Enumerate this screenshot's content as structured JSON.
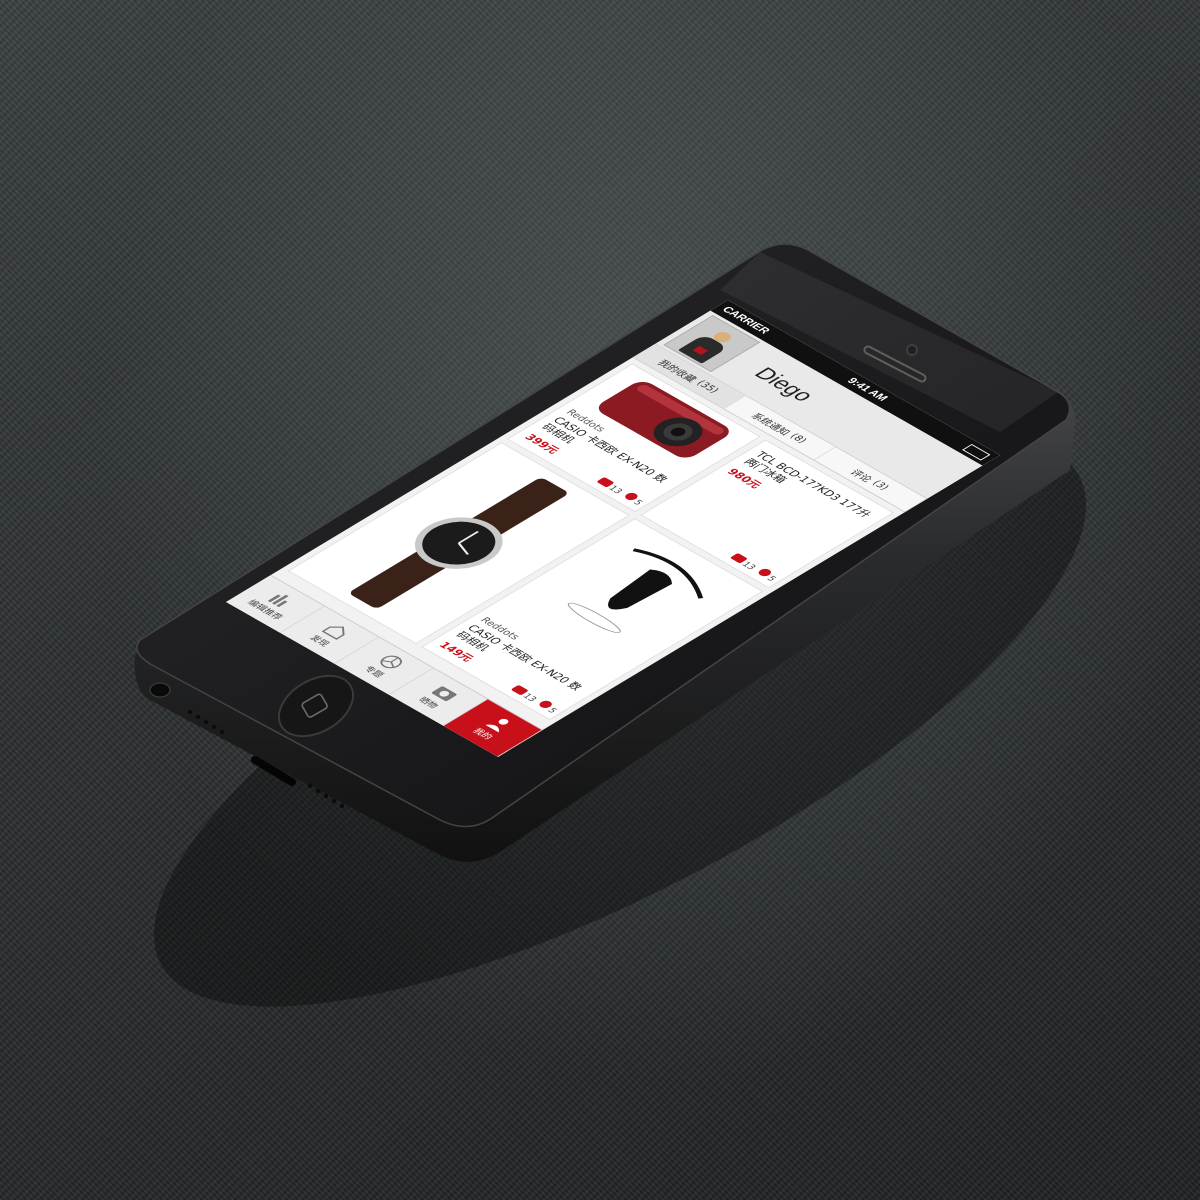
{
  "status": {
    "carrier": "CARRIER",
    "time": "9:41 AM"
  },
  "profile": {
    "name": "Diego"
  },
  "tabs": [
    {
      "label": "我的收藏",
      "count": "(35)"
    },
    {
      "label": "系统通知",
      "count": "(8)"
    },
    {
      "label": "评论",
      "count": "(3)"
    }
  ],
  "cards": [
    {
      "brand": "Reddots",
      "title": "CASIO 卡西欧 EX-N20 数码相机",
      "price": "399元",
      "comments": "13",
      "likes": "5"
    },
    {
      "brand": "",
      "title": "TCL BCD-177KD3 177升两门冰箱",
      "price": "980元",
      "comments": "13",
      "likes": "5"
    },
    {
      "brand": "",
      "title": "",
      "price": "",
      "comments": "",
      "likes": ""
    },
    {
      "brand": "Reddots",
      "title": "CASIO 卡西欧 EX-N20 数码相机",
      "price": "149元",
      "comments": "13",
      "likes": "5"
    }
  ],
  "tabbar": [
    {
      "label": "编辑推荐",
      "icon": "bars-icon"
    },
    {
      "label": "发现",
      "icon": "house-icon"
    },
    {
      "label": "专题",
      "icon": "pie-icon"
    },
    {
      "label": "晒物",
      "icon": "camera-icon"
    },
    {
      "label": "我的",
      "icon": "person-icon"
    }
  ],
  "colors": {
    "accent": "#c8101a"
  }
}
